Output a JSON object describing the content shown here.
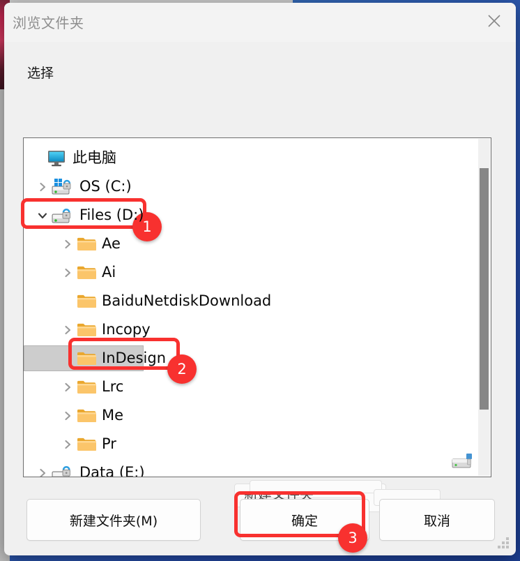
{
  "window": {
    "title": "浏览文件夹",
    "close_icon": "close-icon"
  },
  "prompt": {
    "label": "选择"
  },
  "tree": {
    "items": [
      {
        "label": "此电脑",
        "icon": "computer-icon",
        "level": 0,
        "expander": "none",
        "selected": false
      },
      {
        "label": "OS (C:)",
        "icon": "drive-os-icon",
        "level": 1,
        "expander": "collapsed",
        "selected": false
      },
      {
        "label": "Files (D:)",
        "icon": "drive-icon",
        "level": 1,
        "expander": "expanded",
        "selected": false
      },
      {
        "label": "Ae",
        "icon": "folder-icon",
        "level": 2,
        "expander": "collapsed",
        "selected": false
      },
      {
        "label": "Ai",
        "icon": "folder-icon",
        "level": 2,
        "expander": "collapsed",
        "selected": false
      },
      {
        "label": "BaiduNetdiskDownload",
        "icon": "folder-icon",
        "level": 2,
        "expander": "none",
        "selected": false
      },
      {
        "label": "Incopy",
        "icon": "folder-icon",
        "level": 2,
        "expander": "collapsed",
        "selected": false
      },
      {
        "label": "InDesign",
        "icon": "folder-icon",
        "level": 2,
        "expander": "none",
        "selected": true
      },
      {
        "label": "Lrc",
        "icon": "folder-icon",
        "level": 2,
        "expander": "collapsed",
        "selected": false
      },
      {
        "label": "Me",
        "icon": "folder-icon",
        "level": 2,
        "expander": "collapsed",
        "selected": false
      },
      {
        "label": "Pr",
        "icon": "folder-icon",
        "level": 2,
        "expander": "collapsed",
        "selected": false
      },
      {
        "label": "Data (E:)",
        "icon": "drive-icon",
        "level": 1,
        "expander": "collapsed",
        "selected": false
      }
    ],
    "selected_label": "InDesign"
  },
  "buttons": {
    "new_folder": "新建文件夹(M)",
    "ok": "确定",
    "cancel": "取消"
  },
  "artifact": {
    "ghost_text": "新建文件夹"
  },
  "annotations": [
    {
      "number": "1",
      "target": "Files (D:)"
    },
    {
      "number": "2",
      "target": "InDesign"
    },
    {
      "number": "3",
      "target": "确定"
    }
  ],
  "colors": {
    "annotation_red": "#f8312f",
    "selection_gray": "#cdcdcd",
    "dialog_bg": "#f0f0f0",
    "desktop_blue": "#2449a6"
  }
}
